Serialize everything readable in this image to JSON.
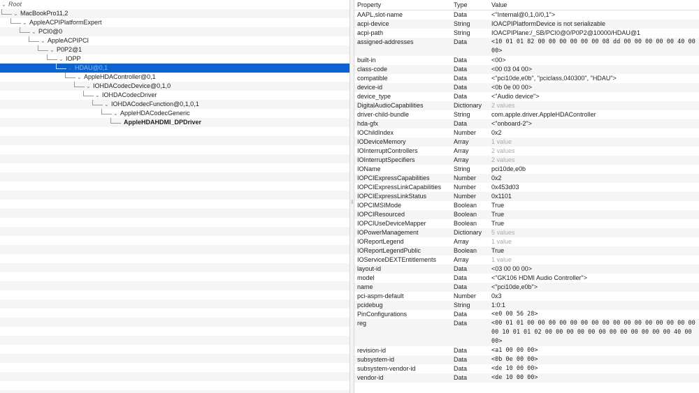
{
  "tree": {
    "root_label": "Root",
    "nodes": [
      {
        "label": "MacBookPro11,2",
        "level": 1
      },
      {
        "label": "AppleACPIPlatformExpert",
        "level": 2
      },
      {
        "label": "PCI0@0",
        "level": 3
      },
      {
        "label": "AppleACPIPCI",
        "level": 4
      },
      {
        "label": "P0P2@1",
        "level": 5
      },
      {
        "label": "IOPP",
        "level": 6
      },
      {
        "label": "HDAU@0,1",
        "level": 7,
        "selected": true
      },
      {
        "label": "AppleHDAController@0,1",
        "level": 8
      },
      {
        "label": "IOHDACodecDevice@0,1,0",
        "level": 9
      },
      {
        "label": "IOHDACodecDriver",
        "level": 10
      },
      {
        "label": "IOHDACodecFunction@0,1,0,1",
        "level": 11
      },
      {
        "label": "AppleHDACodecGeneric",
        "level": 12
      },
      {
        "label": "AppleHDAHDMI_DPDriver",
        "level": 13,
        "bold": true
      }
    ]
  },
  "table": {
    "headers": {
      "property": "Property",
      "type": "Type",
      "value": "Value"
    },
    "rows": [
      {
        "name": "AAPL,slot-name",
        "type": "Data",
        "value": "<\"Internal@0,1,0/0,1\">"
      },
      {
        "name": "acpi-device",
        "type": "String",
        "value": "IOACPIPlatformDevice is not serializable"
      },
      {
        "name": "acpi-path",
        "type": "String",
        "value": "IOACPIPlane:/_SB/PCI0@0/P0P2@10000/HDAU@1"
      },
      {
        "name": "assigned-addresses",
        "type": "Data",
        "value": "<10 01 01 82 00 00 00 00 00 00 08 dd 00 00 00 00 00 40 00 00>",
        "mono": true,
        "lines": 2
      },
      {
        "name": "built-in",
        "type": "Data",
        "value": "<00>"
      },
      {
        "name": "class-code",
        "type": "Data",
        "value": "<00 03 04 00>"
      },
      {
        "name": "compatible",
        "type": "Data",
        "value": "<\"pci10de,e0b\", \"pciclass,040300\", \"HDAU\">"
      },
      {
        "name": "device-id",
        "type": "Data",
        "value": "<0b 0e 00 00>"
      },
      {
        "name": "device_type",
        "type": "Data",
        "value": "<\"Audio device\">"
      },
      {
        "name": "DigitalAudioCapabilities",
        "type": "Dictionary",
        "value": "2 values",
        "expand": true,
        "dim": true
      },
      {
        "name": "driver-child-bundle",
        "type": "String",
        "value": "com.apple.driver.AppleHDAController"
      },
      {
        "name": "hda-gfx",
        "type": "Data",
        "value": "<\"onboard-2\">"
      },
      {
        "name": "IOChildIndex",
        "type": "Number",
        "value": "0x2"
      },
      {
        "name": "IODeviceMemory",
        "type": "Array",
        "value": "1 value",
        "expand": true,
        "dim": true
      },
      {
        "name": "IOInterruptControllers",
        "type": "Array",
        "value": "2 values",
        "expand": true,
        "dim": true
      },
      {
        "name": "IOInterruptSpecifiers",
        "type": "Array",
        "value": "2 values",
        "expand": true,
        "dim": true
      },
      {
        "name": "IOName",
        "type": "String",
        "value": "pci10de,e0b"
      },
      {
        "name": "IOPCIExpressCapabilities",
        "type": "Number",
        "value": "0x2"
      },
      {
        "name": "IOPCIExpressLinkCapabilities",
        "type": "Number",
        "value": "0x453d03"
      },
      {
        "name": "IOPCIExpressLinkStatus",
        "type": "Number",
        "value": "0x1101"
      },
      {
        "name": "IOPCIMSIMode",
        "type": "Boolean",
        "value": "True"
      },
      {
        "name": "IOPCIResourced",
        "type": "Boolean",
        "value": "True"
      },
      {
        "name": "IOPCIUseDeviceMapper",
        "type": "Boolean",
        "value": "True"
      },
      {
        "name": "IOPowerManagement",
        "type": "Dictionary",
        "value": "5 values",
        "expand": true,
        "dim": true
      },
      {
        "name": "IOReportLegend",
        "type": "Array",
        "value": "1 value",
        "expand": true,
        "dim": true
      },
      {
        "name": "IOReportLegendPublic",
        "type": "Boolean",
        "value": "True"
      },
      {
        "name": "IOServiceDEXTEntitlements",
        "type": "Array",
        "value": "1 value",
        "expand": true,
        "dim": true
      },
      {
        "name": "layout-id",
        "type": "Data",
        "value": "<03 00 00 00>"
      },
      {
        "name": "model",
        "type": "Data",
        "value": "<\"GK106 HDMI Audio Controller\">"
      },
      {
        "name": "name",
        "type": "Data",
        "value": "<\"pci10de,e0b\">"
      },
      {
        "name": "pci-aspm-default",
        "type": "Number",
        "value": "0x3"
      },
      {
        "name": "pcidebug",
        "type": "String",
        "value": "1:0:1"
      },
      {
        "name": "PinConfigurations",
        "type": "Data",
        "value": "<e0 00 56 28>",
        "mono": true
      },
      {
        "name": "reg",
        "type": "Data",
        "value": "<00 01 01 00 00 00 00 00 00 00 00 00 00 00 00 00 00 00 00 00 10 01 01 02 00 00 00 00 00 00 00 00 00 00 00 00 40 00 00>",
        "mono": true,
        "lines": 3
      },
      {
        "name": "revision-id",
        "type": "Data",
        "value": "<a1 00 00 00>",
        "mono": true
      },
      {
        "name": "subsystem-id",
        "type": "Data",
        "value": "<0b 0e 00 00>",
        "mono": true
      },
      {
        "name": "subsystem-vendor-id",
        "type": "Data",
        "value": "<de 10 00 00>",
        "mono": true
      },
      {
        "name": "vendor-id",
        "type": "Data",
        "value": "<de 10 00 00>",
        "mono": true
      }
    ]
  }
}
